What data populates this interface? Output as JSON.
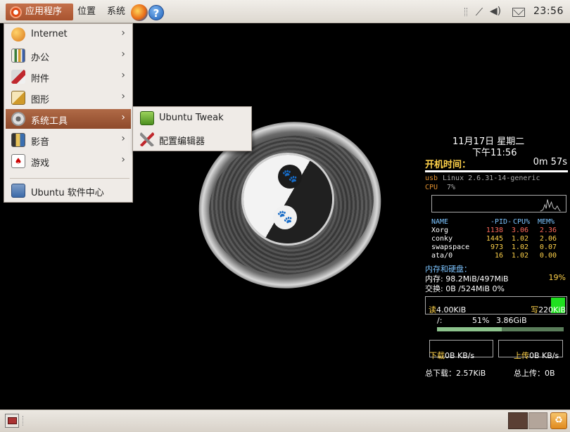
{
  "top_panel": {
    "applications_label": "应用程序",
    "places_label": "位置",
    "system_label": "系统",
    "help_glyph": "?",
    "clock": "23:56"
  },
  "app_menu": {
    "items": [
      {
        "label": "Internet",
        "icon": "globe-icon",
        "submenu": true
      },
      {
        "label": "办公",
        "icon": "office-chart-icon",
        "submenu": true
      },
      {
        "label": "附件",
        "icon": "accessories-icon",
        "submenu": true
      },
      {
        "label": "图形",
        "icon": "graphics-icon",
        "submenu": true
      },
      {
        "label": "系统工具",
        "icon": "gear-icon",
        "submenu": true,
        "active": true
      },
      {
        "label": "影音",
        "icon": "multimedia-icon",
        "submenu": true
      },
      {
        "label": "游戏",
        "icon": "cards-icon",
        "submenu": true
      },
      {
        "label": "Ubuntu 软件中心",
        "icon": "software-center-icon",
        "submenu": false
      }
    ],
    "arrow": "›"
  },
  "sub_menu": {
    "items": [
      {
        "label": "Ubuntu Tweak",
        "icon": "ubuntu-tweak-icon"
      },
      {
        "label": "配置编辑器",
        "icon": "tools-icon"
      }
    ]
  },
  "conky": {
    "date": "11月17日 星期二",
    "time": "下午11:56",
    "uptime_label": "开机时间：",
    "uptime": "0m 57s",
    "usb": "usb",
    "kernel": "Linux 2.6.31-14-generic",
    "cpu_label": "CPU",
    "cpu": "7%",
    "proc_headers": {
      "name": "NAME",
      "pid": "-PID-",
      "cpu": "CPU%",
      "mem": "MEM%"
    },
    "processes": [
      {
        "name": "Xorg",
        "pid": "1138",
        "cpu": "3.06",
        "mem": "2.36"
      },
      {
        "name": "conky",
        "pid": "1445",
        "cpu": "1.02",
        "mem": "2.06"
      },
      {
        "name": "swapspace",
        "pid": "973",
        "cpu": "1.02",
        "mem": "0.07"
      },
      {
        "name": "ata/0",
        "pid": "16",
        "cpu": "1.02",
        "mem": "0.00"
      }
    ],
    "mem_header": "内存和硬盘：",
    "mem": "内存: 98.2MiB/497MiB",
    "mem_pct": "19%",
    "swap": "交换: 0B /524MiB 0%",
    "read_label": "读",
    "read_value": "4.00KiB",
    "write_label": "写",
    "write_value": "220KiB",
    "fs_mount": "/:",
    "fs_pct": "51%",
    "fs_free": "3.86GiB",
    "fs_fill_fraction": 0.51,
    "download_label": "下载",
    "download_value": "0B  KB/s",
    "upload_label": "上传",
    "upload_value": "0B  KB/s",
    "total_download": "总下载：2.57KiB",
    "total_upload": "总上传：0B",
    "colors": {
      "accent": "#ffd24a",
      "pid_red": "#ff6a5a",
      "cpu_yellow": "#ffd24a"
    }
  }
}
